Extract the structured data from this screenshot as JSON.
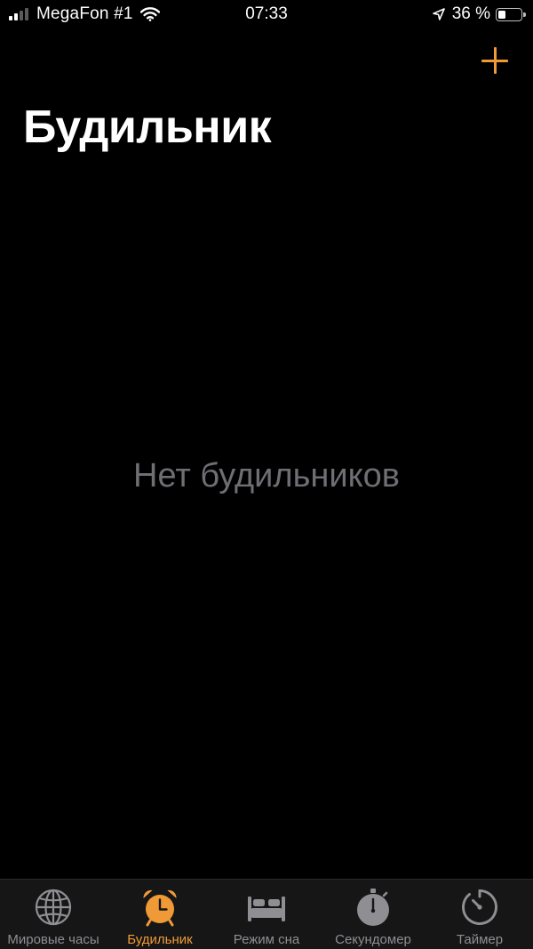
{
  "status_bar": {
    "carrier": "MegaFon #1",
    "time": "07:33",
    "battery_text": "36 %",
    "battery_level": 0.36,
    "signal_bars_filled": 2,
    "signal_bars_total": 4
  },
  "header": {
    "title": "Будильник",
    "add_icon": "plus-icon"
  },
  "empty_state": {
    "text": "Нет будильников"
  },
  "tab_bar": {
    "tabs": [
      {
        "label": "Мировые часы",
        "icon": "globe-icon"
      },
      {
        "label": "Будильник",
        "icon": "alarm-clock-icon",
        "active": true
      },
      {
        "label": "Режим сна",
        "icon": "bed-icon"
      },
      {
        "label": "Секундомер",
        "icon": "stopwatch-icon"
      },
      {
        "label": "Таймер",
        "icon": "timer-icon"
      }
    ]
  },
  "colors": {
    "background": "#000000",
    "accent": "#f09a37",
    "inactive": "#8e8e93",
    "empty_text": "#6e6e73",
    "tab_bar_background": "#161616"
  }
}
